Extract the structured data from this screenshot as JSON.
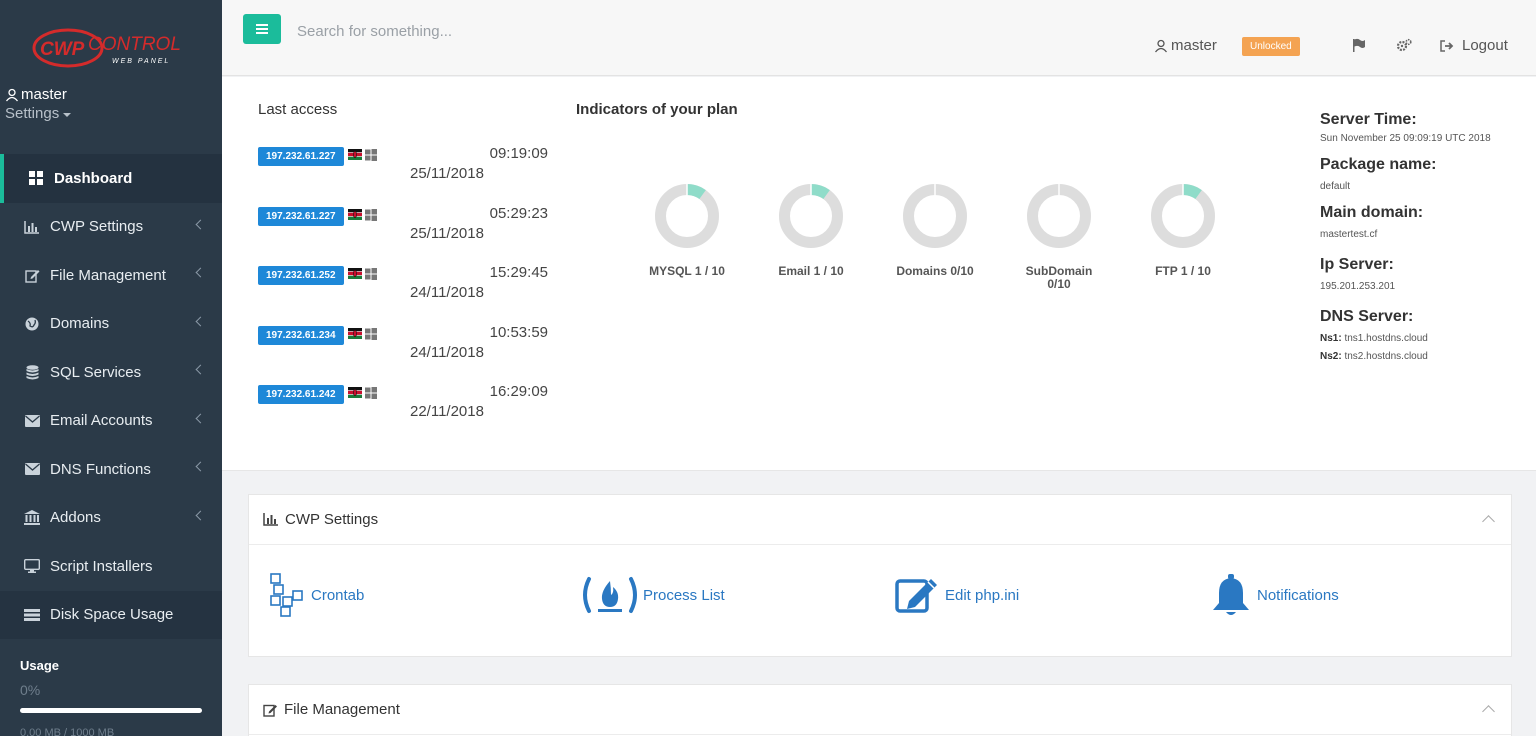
{
  "sidebar": {
    "logo_primary": "CWP",
    "logo_secondary": "CONTROL",
    "logo_tagline": "WEB PANEL",
    "user_name": "master",
    "settings_label": "Settings",
    "items": [
      {
        "label": "Dashboard",
        "icon": "dashboard-icon"
      },
      {
        "label": "CWP Settings",
        "icon": "bar-chart-icon"
      },
      {
        "label": "File Management",
        "icon": "edit-icon"
      },
      {
        "label": "Domains",
        "icon": "globe-icon"
      },
      {
        "label": "SQL Services",
        "icon": "database-icon"
      },
      {
        "label": "Email Accounts",
        "icon": "envelope-icon"
      },
      {
        "label": "DNS Functions",
        "icon": "envelope-icon"
      },
      {
        "label": "Addons",
        "icon": "bank-icon"
      },
      {
        "label": "Script Installers",
        "icon": "desktop-icon"
      },
      {
        "label": "Disk Space Usage",
        "icon": "hdd-icon"
      }
    ],
    "usage": {
      "label": "Usage",
      "percent": "0%",
      "detail": "0.00 MB / 1000 MB"
    }
  },
  "topbar": {
    "search_placeholder": "Search for something...",
    "user": "master",
    "badge": "Unlocked",
    "logout": "Logout"
  },
  "dashboard": {
    "last_access_title": "Last access",
    "last_access": [
      {
        "ip": "197.232.61.227",
        "time": "09:19:09",
        "date": "25/11/2018"
      },
      {
        "ip": "197.232.61.227",
        "time": "05:29:23",
        "date": "25/11/2018"
      },
      {
        "ip": "197.232.61.252",
        "time": "15:29:45",
        "date": "24/11/2018"
      },
      {
        "ip": "197.232.61.234",
        "time": "10:53:59",
        "date": "24/11/2018"
      },
      {
        "ip": "197.232.61.242",
        "time": "16:29:09",
        "date": "22/11/2018"
      }
    ],
    "indicators_title": "Indicators of your plan",
    "indicators": [
      {
        "label": "MYSQL 1 / 10",
        "used": 1,
        "total": 10
      },
      {
        "label": "Email 1 / 10",
        "used": 1,
        "total": 10
      },
      {
        "label": "Domains 0/10",
        "used": 0,
        "total": 10
      },
      {
        "label": "SubDomain 0/10",
        "used": 0,
        "total": 10
      },
      {
        "label": "FTP 1 / 10",
        "used": 1,
        "total": 10
      }
    ],
    "colors": {
      "used": "#8fdcc9",
      "free": "#dddddd",
      "accent": "#1bbc9b",
      "ip_tag": "#1e88d8"
    },
    "server": {
      "time_label": "Server Time:",
      "time_value": "Sun November 25 09:09:19 UTC 2018",
      "package_label": "Package name:",
      "package_value": "default",
      "domain_label": "Main domain:",
      "domain_value": "mastertest.cf",
      "ip_label": "Ip Server:",
      "ip_value": "195.201.253.201",
      "dns_label": "DNS Server:",
      "ns1_label": "Ns1:",
      "ns1_value": "tns1.hostdns.cloud",
      "ns2_label": "Ns2:",
      "ns2_value": "tns2.hostdns.cloud"
    }
  },
  "cwp_panel": {
    "title": "CWP Settings",
    "tools": [
      {
        "label": "Crontab",
        "icon": "boxes-icon"
      },
      {
        "label": "Process List",
        "icon": "process-fire-icon"
      },
      {
        "label": "Edit php.ini",
        "icon": "edit-file-icon"
      },
      {
        "label": "Notifications",
        "icon": "bell-icon"
      }
    ]
  },
  "file_panel": {
    "title": "File Management"
  }
}
